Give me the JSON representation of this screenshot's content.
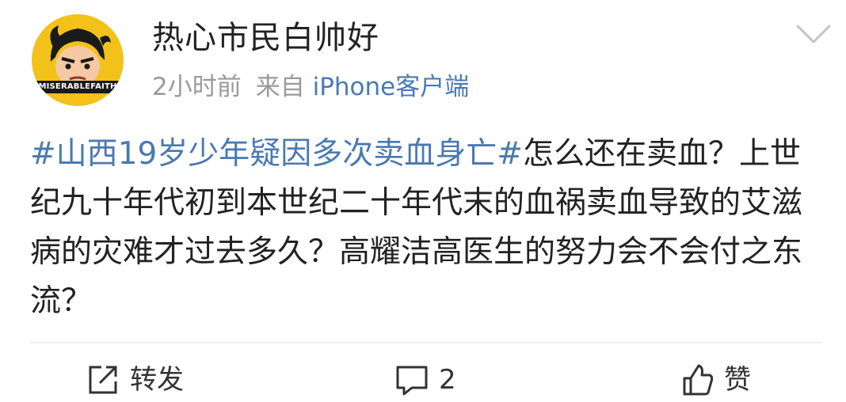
{
  "post": {
    "username": "热心市民白帅好",
    "time": "2小时前",
    "from_label": "来自",
    "source": "iPhone客户端",
    "topic": "#山西19岁少年疑因多次卖血身亡#",
    "body": "怎么还在卖血？上世纪九十年代初到本世纪二十年代末的血祸卖血导致的艾滋病的灾难才过去多久？高耀洁高医生的努力会不会付之东流？",
    "avatar_text": "MISERABLEFAITH"
  },
  "actions": {
    "repost_label": "转发",
    "comment_count": "2",
    "like_label": "赞"
  },
  "colors": {
    "link": "#4a7ab0",
    "muted": "#9a9a9a",
    "avatar_bg": "#f2c21b"
  },
  "icons": [
    "chevron-down-icon",
    "repost-icon",
    "comment-icon",
    "like-icon"
  ]
}
